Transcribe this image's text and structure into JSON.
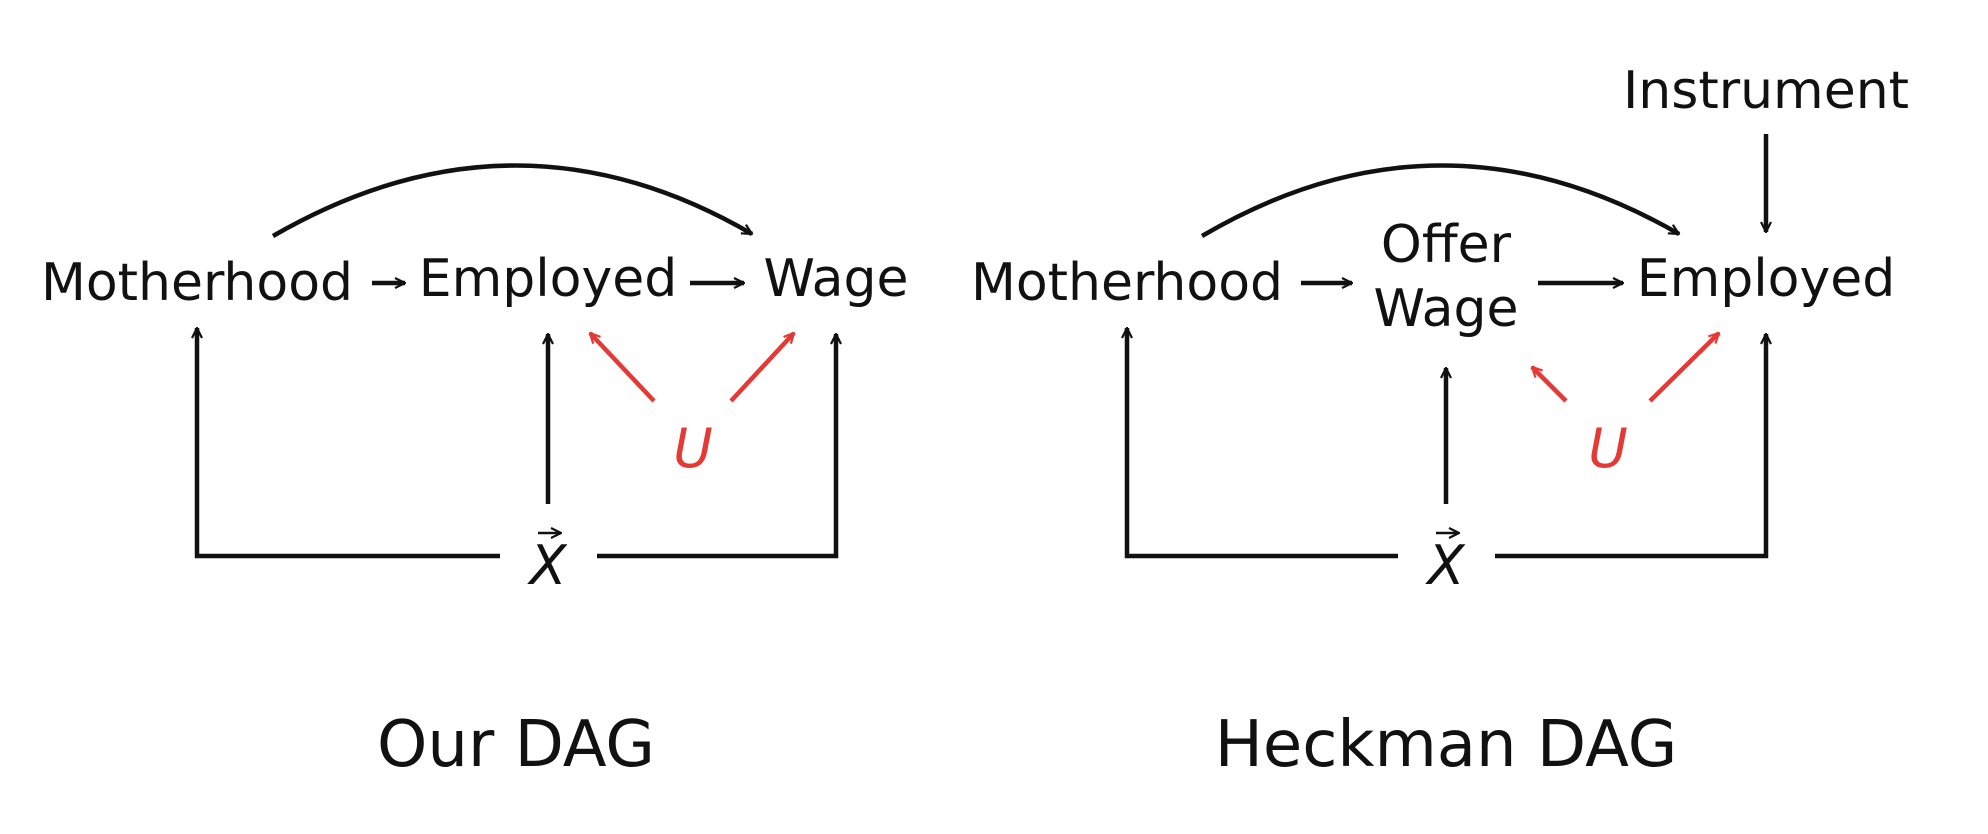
{
  "colors": {
    "ink": "#111111",
    "confounder": "#e53935"
  },
  "left_dag": {
    "caption": "Our DAG",
    "nodes": {
      "motherhood": "Motherhood",
      "employed": "Employed",
      "wage": "Wage",
      "unobserved": "U",
      "covariates": "X"
    }
  },
  "right_dag": {
    "caption": "Heckman DAG",
    "nodes": {
      "motherhood": "Motherhood",
      "offer_wage_line1": "Offer",
      "offer_wage_line2": "Wage",
      "employed": "Employed",
      "instrument": "Instrument",
      "unobserved": "U",
      "covariates": "X"
    }
  }
}
